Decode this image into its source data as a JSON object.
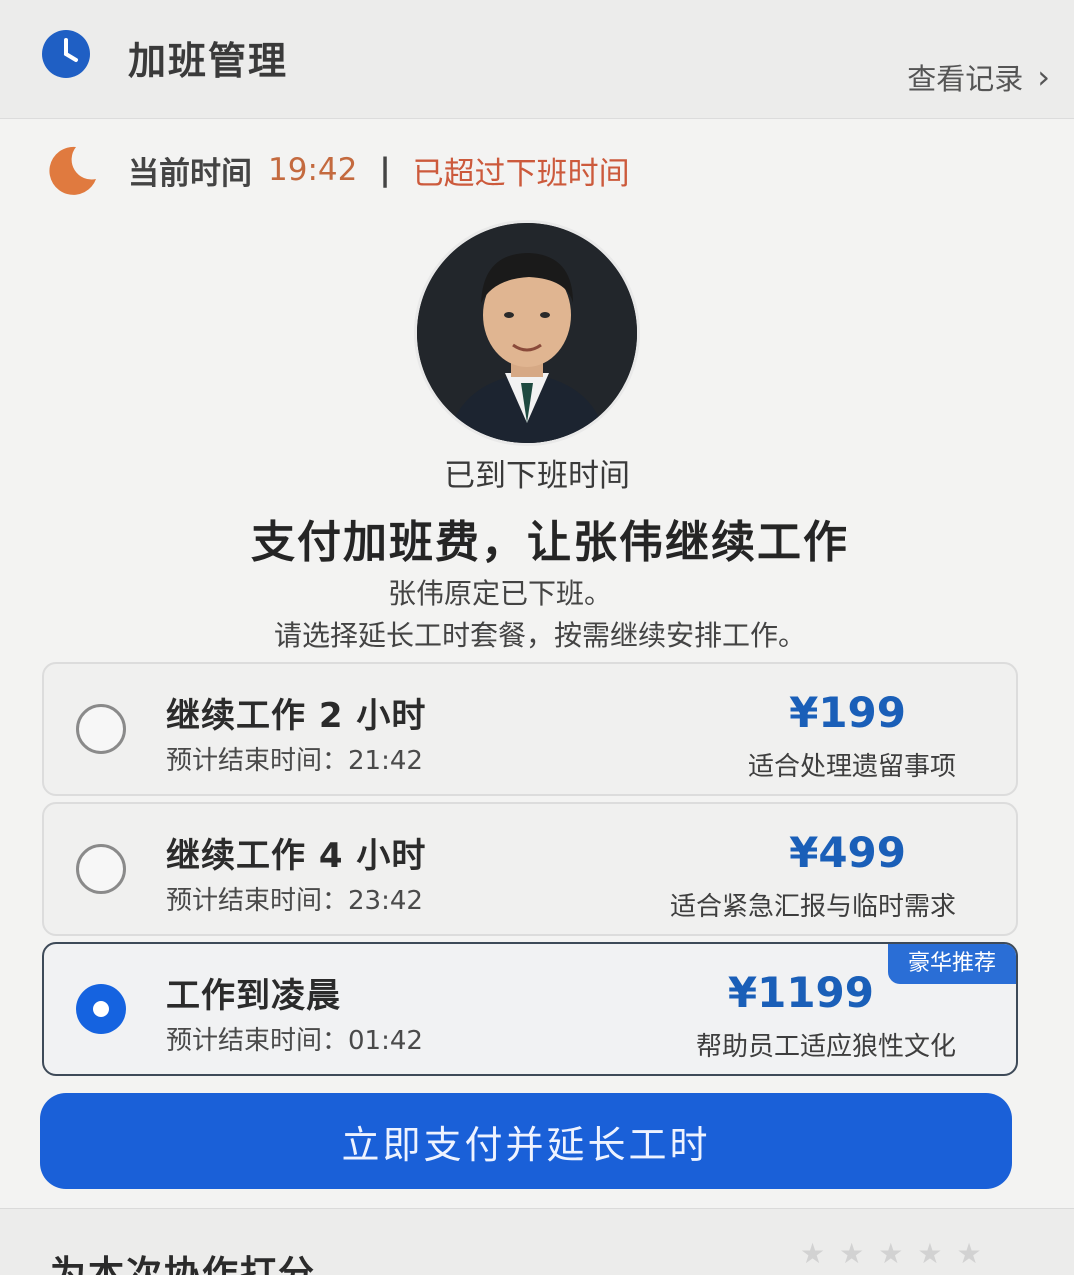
{
  "header": {
    "title": "加班管理",
    "records_link": "查看记录",
    "records_chevron": "›",
    "icon": "clock-icon"
  },
  "status": {
    "icon": "moon-icon",
    "time_label": "当前时间",
    "time_value": "19:42",
    "separator": "|",
    "warning": "已超过下班时间"
  },
  "employee": {
    "avatar_icon": "employee-avatar",
    "offwork_text": "已到下班时间",
    "heading": "支付加班费，让张伟继续工作",
    "subtext_line1": "张伟原定已下班。",
    "subtext_line2": "请选择延长工时套餐，按需继续安排工作。"
  },
  "plans": [
    {
      "title": "继续工作 2 小时",
      "end_time": "预计结束时间：21:42",
      "price": "¥199",
      "description": "适合处理遗留事项",
      "selected": false,
      "badge": ""
    },
    {
      "title": "继续工作 4 小时",
      "end_time": "预计结束时间：23:42",
      "price": "¥499",
      "description": "适合紧急汇报与临时需求",
      "selected": false,
      "badge": ""
    },
    {
      "title": "工作到凌晨",
      "end_time": "预计结束时间：01:42",
      "price": "¥1199",
      "description": "帮助员工适应狼性文化",
      "selected": true,
      "badge": "豪华推荐"
    }
  ],
  "pay_button": "立即支付并延长工时",
  "rating": {
    "heading": "为本次协作打分",
    "stars": [
      "★",
      "★",
      "★",
      "★",
      "★"
    ]
  },
  "colors": {
    "accent": "#1a60d8",
    "price": "#1a5fb8",
    "warning": "#cc5a3c",
    "time": "#c46a3f",
    "moon": "#e07a3f"
  }
}
